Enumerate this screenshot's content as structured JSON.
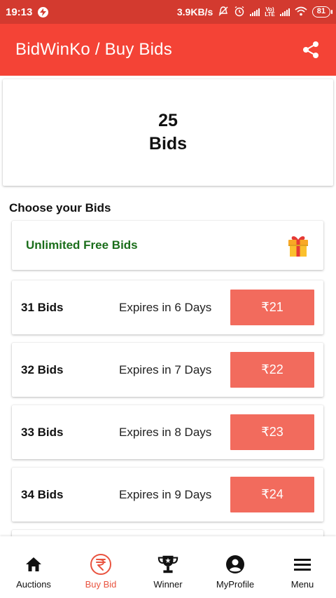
{
  "status_bar": {
    "time": "19:13",
    "net_speed": "3.9KB/s",
    "volte": "Vo)\nLTE",
    "battery": "81"
  },
  "app_bar": {
    "title": "BidWinKo / Buy Bids",
    "share_icon": "share-icon"
  },
  "summary": {
    "count": "25",
    "label": "Bids"
  },
  "section_heading": "Choose your Bids",
  "free_bids": {
    "label": "Unlimited Free Bids",
    "icon": "gift-icon"
  },
  "packages": [
    {
      "name": "31 Bids",
      "expiry": "Expires in 6 Days",
      "price": "₹21"
    },
    {
      "name": "32 Bids",
      "expiry": "Expires in 7 Days",
      "price": "₹22"
    },
    {
      "name": "33 Bids",
      "expiry": "Expires in 8 Days",
      "price": "₹23"
    },
    {
      "name": "34 Bids",
      "expiry": "Expires in 9 Days",
      "price": "₹24"
    }
  ],
  "bottom_nav": {
    "items": [
      {
        "label": "Auctions",
        "icon": "home-icon"
      },
      {
        "label": "Buy Bid",
        "icon": "rupee-icon"
      },
      {
        "label": "Winner",
        "icon": "trophy-icon"
      },
      {
        "label": "MyProfile",
        "icon": "profile-icon"
      },
      {
        "label": "Menu",
        "icon": "menu-icon"
      }
    ],
    "active_index": 1
  },
  "colors": {
    "status_bar": "#d33a2f",
    "app_bar": "#f44336",
    "price_button": "#f26b5d",
    "free_label": "#1b6e1b",
    "active_nav": "#e9533f"
  }
}
